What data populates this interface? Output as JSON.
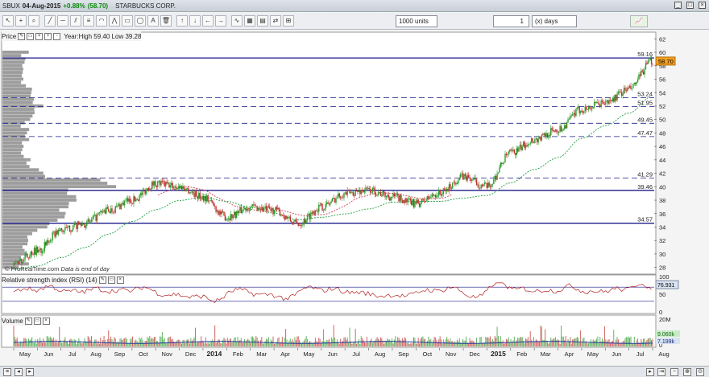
{
  "header": {
    "symbol": "SBUX",
    "date": "04-Aug-2015",
    "change": "+0.88%",
    "price_paren": "(58.70)",
    "company": "STARBUCKS CORP."
  },
  "toolbar": {
    "units_value": "1000 units",
    "period_value": "1",
    "period_unit": "(x) days"
  },
  "price_panel": {
    "label": "Price",
    "year_range": "Year:High 59.40 Low 39.28",
    "watermark": "© ProRealTime.com",
    "watermark_note": "Data is end of day",
    "current_price": "58.70",
    "y_ticks": [
      "28",
      "30",
      "32",
      "34",
      "36",
      "38",
      "40",
      "42",
      "44",
      "46",
      "48",
      "50",
      "52",
      "54",
      "56",
      "58",
      "60",
      "62"
    ],
    "levels": [
      {
        "value": 59.16,
        "label": "59.16",
        "style": "solid"
      },
      {
        "value": 53.24,
        "label": "53.24",
        "style": "dashed"
      },
      {
        "value": 51.95,
        "label": "51.95",
        "style": "dashed"
      },
      {
        "value": 49.45,
        "label": "49.45",
        "style": "dashed"
      },
      {
        "value": 47.47,
        "label": "47.47",
        "style": "dashed"
      },
      {
        "value": 41.29,
        "label": "41.29",
        "style": "dashed"
      },
      {
        "value": 39.46,
        "label": "39.46",
        "style": "solid"
      },
      {
        "value": 34.57,
        "label": "34.57",
        "style": "solid"
      }
    ]
  },
  "rsi_panel": {
    "label": "Relative strength index (RSI) (14)",
    "value": "76.931",
    "y_ticks": [
      "0",
      "50",
      "100"
    ]
  },
  "volume_panel": {
    "label": "Volume",
    "y_top": "20M",
    "y_zero": "0",
    "value1": "9.060k",
    "value2": "7.199k"
  },
  "x_axis": {
    "labels": [
      "May",
      "Jun",
      "Jul",
      "Aug",
      "Sep",
      "Oct",
      "Nov",
      "Dec",
      "2014",
      "Feb",
      "Mar",
      "Apr",
      "May",
      "Jun",
      "Jul",
      "Aug",
      "Sep",
      "Oct",
      "Nov",
      "Dec",
      "2015",
      "Feb",
      "Mar",
      "Apr",
      "May",
      "Jun",
      "Jul",
      "Aug"
    ]
  },
  "colors": {
    "up": "#2e9e2e",
    "down": "#c0302e",
    "level_line": "#1a1a8c",
    "ma_fast": "#d04050",
    "ma_slow": "#20a040",
    "profile": "#8c8c8c",
    "rsi_line": "#b02020"
  },
  "chart_data": {
    "type": "line",
    "title": "SBUX 04-Aug-2015 STARBUCKS CORP.",
    "x": [
      "2013-05",
      "2013-06",
      "2013-07",
      "2013-08",
      "2013-09",
      "2013-10",
      "2013-11",
      "2013-12",
      "2014-01",
      "2014-02",
      "2014-03",
      "2014-04",
      "2014-05",
      "2014-06",
      "2014-07",
      "2014-08",
      "2014-09",
      "2014-10",
      "2014-11",
      "2014-12",
      "2015-01",
      "2015-02",
      "2015-03",
      "2015-04",
      "2015-05",
      "2015-06",
      "2015-07",
      "2015-08"
    ],
    "series": [
      {
        "name": "Price",
        "values": [
          28.5,
          30.5,
          33.5,
          34.5,
          36.5,
          38.0,
          40.5,
          40.0,
          38.5,
          35.5,
          37.0,
          36.5,
          34.5,
          37.0,
          39.0,
          39.5,
          38.5,
          37.5,
          39.0,
          41.5,
          40.0,
          45.0,
          47.0,
          48.5,
          51.5,
          52.5,
          54.5,
          58.7
        ]
      }
    ],
    "ylim": [
      27,
      63
    ],
    "grid": false
  }
}
